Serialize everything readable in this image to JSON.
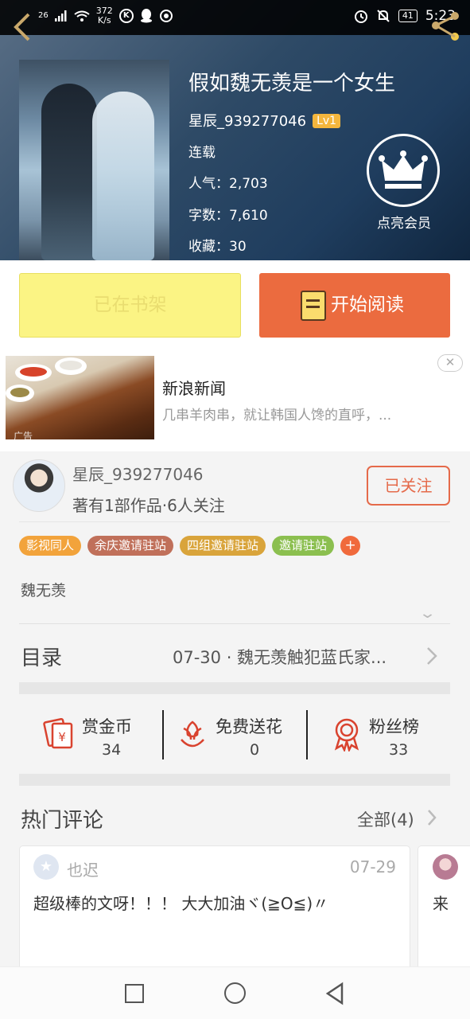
{
  "status_bar": {
    "signal": "26",
    "speed_value": "372",
    "speed_unit": "K/s",
    "battery": "41",
    "time": "5:23"
  },
  "book": {
    "title": "假如魏无羡是一个女生",
    "author": "星辰_939277046",
    "level": "Lv1",
    "status": "连载",
    "popularity": "人气：2,703",
    "word_count": "字数：7,610",
    "favorites": "收藏：30",
    "vip_label": "点亮会员"
  },
  "actions": {
    "shelf_label": "已在书架",
    "read_label": "开始阅读"
  },
  "ad": {
    "title": "新浪新闻",
    "description": "几串羊肉串，就让韩国人馋的直呼，...",
    "tag": "广告",
    "close": "✕"
  },
  "author_card": {
    "name": "星辰_939277046",
    "info": "著有1部作品·6人关注",
    "follow_label": "已关注"
  },
  "tags": [
    {
      "label": "影视同人",
      "color": "#f2a33b"
    },
    {
      "label": "余庆邀请驻站",
      "color": "#c0705a"
    },
    {
      "label": "四组邀请驻站",
      "color": "#d9a43b"
    },
    {
      "label": "邀请驻站",
      "color": "#8bbf4f"
    },
    {
      "label": "+",
      "color": "#f06a3c"
    }
  ],
  "keyword": "魏无羡",
  "catalog": {
    "label": "目录",
    "latest": "07-30 · 魏无羡触犯蓝氏家..."
  },
  "stats": [
    {
      "label": "赏金币",
      "value": "34"
    },
    {
      "label": "免费送花",
      "value": "0"
    },
    {
      "label": "粉丝榜",
      "value": "33"
    }
  ],
  "hot_comments": {
    "label": "热门评论",
    "all_label": "全部(4)",
    "items": [
      {
        "name": "也迟",
        "date": "07-29",
        "text": "超级棒的文呀！！！ 大大加油ヾ(≧O≦)〃"
      },
      {
        "name": "",
        "date": "",
        "text": "来"
      }
    ]
  },
  "colors": {
    "accent_orange": "#eb6b3f",
    "shelf_yellow": "#fbf484",
    "follow_red": "#e56a4a",
    "icon_red": "#d9432f"
  }
}
